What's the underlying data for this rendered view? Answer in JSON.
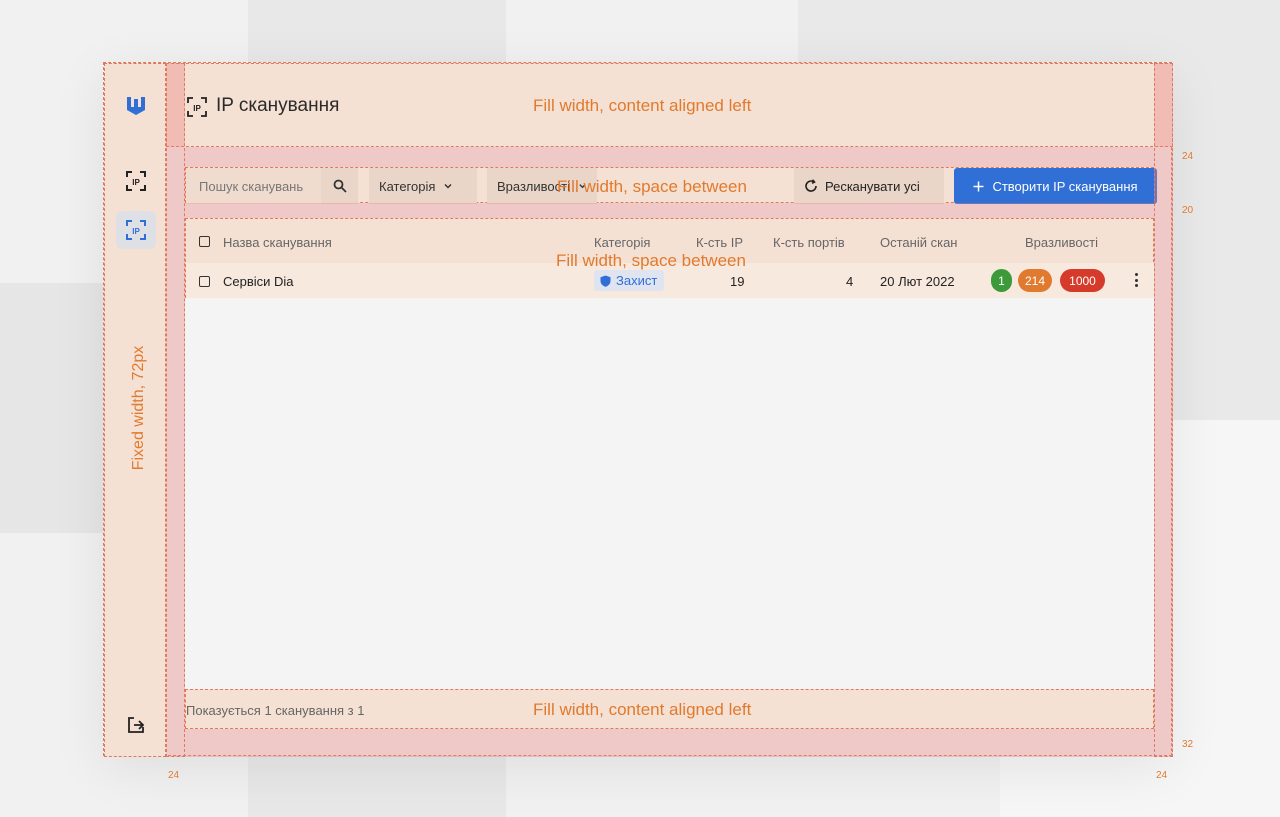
{
  "header": {
    "title": "IP сканування",
    "annotation": "Fill width, content aligned left"
  },
  "sidebar": {
    "annotation": "Fixed width, 72px"
  },
  "toolbar": {
    "search_placeholder": "Пошук сканувань",
    "category_filter": "Категорія",
    "vulnerability_filter": "Вразливості",
    "rescan_label": "Рескaнувати усі",
    "create_label": "Створити IP сканування",
    "annotation": "Fill width, space between"
  },
  "table": {
    "annotation": "Fill width, space between",
    "columns": {
      "name": "Назва сканування",
      "category": "Категорія",
      "ip_count": "К-сть IP",
      "port_count": "К-сть портів",
      "last_scan": "Останій скан",
      "vulnerabilities": "Вразливості"
    },
    "rows": [
      {
        "name": "Сервіси Dia",
        "category": "Захист",
        "ip_count": "19",
        "port_count": "4",
        "last_scan": "20 Лют 2022",
        "vuln_low": "1",
        "vuln_medium": "214",
        "vuln_high": "1000"
      }
    ]
  },
  "footer": {
    "text": "Показується 1 сканування з 1",
    "annotation": "Fill width, content aligned left"
  },
  "spec": {
    "gap_top": "24",
    "gap_toolbar": "20",
    "pad_bottom": "32",
    "pad_left": "24",
    "pad_right": "24"
  },
  "colors": {
    "accent": "#2f6fd6",
    "annotation": "#e07a2e",
    "vuln_low": "#3d9a3a",
    "vuln_medium": "#e07a2e",
    "vuln_high": "#d63a2a"
  }
}
